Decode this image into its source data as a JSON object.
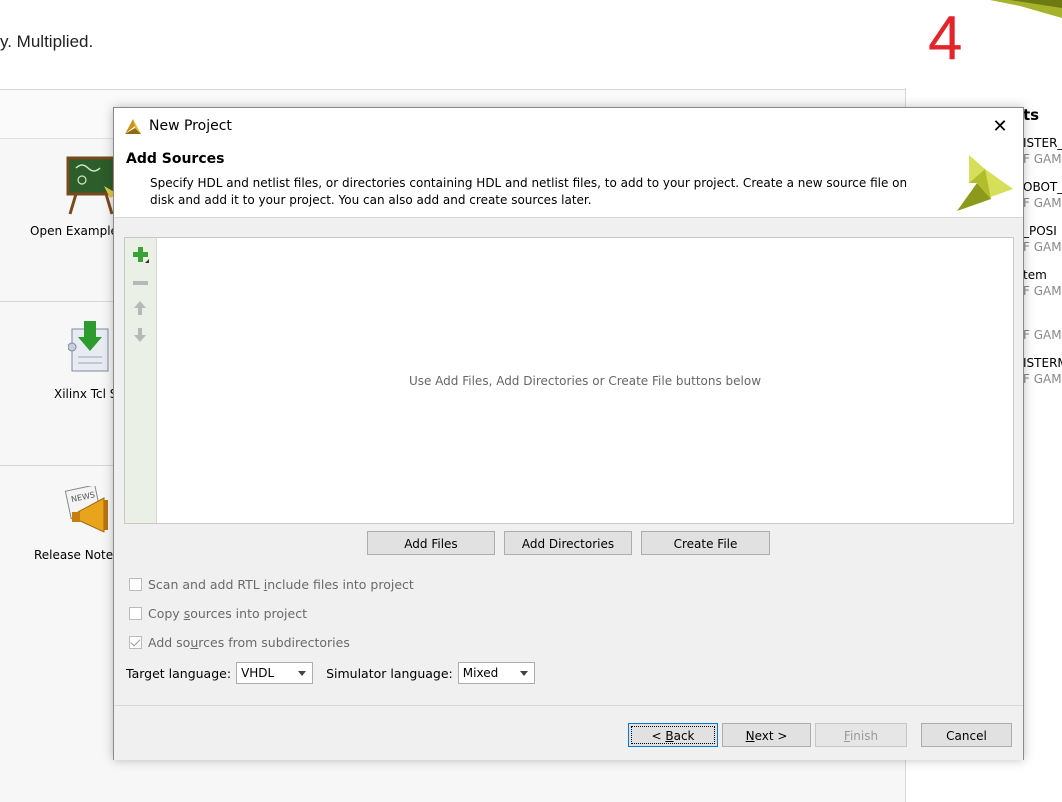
{
  "background": {
    "tagline": "y. Multiplied.",
    "badge_number": "4",
    "left_items": [
      {
        "label": "Open Example",
        "icon": "chalkboard-icon"
      },
      {
        "label": "Xilinx Tcl S",
        "icon": "tcl-store-download-icon"
      },
      {
        "label": "Release Note",
        "icon": "megaphone-news-icon"
      }
    ],
    "right_panel": {
      "heading": "ts",
      "entries": [
        {
          "title": "ISTER_",
          "sub": "F GAMI"
        },
        {
          "title": "OBOT_",
          "sub": "F GAMI"
        },
        {
          "title": "_POSI",
          "sub": "F GAMI"
        },
        {
          "title": "tem",
          "sub": "F GAMI"
        },
        {
          "title": "",
          "sub": "F GAMI"
        },
        {
          "title": "ISTERM",
          "sub": "F GAMI"
        }
      ]
    }
  },
  "dialog": {
    "window_title": "New Project",
    "close_glyph": "✕",
    "header": {
      "title": "Add Sources",
      "description": "Specify HDL and netlist files, or directories containing HDL and netlist files, to add to your project. Create a new source file on disk and add it to your project. You can also add and create sources later."
    },
    "toolbar": {
      "add_icon": "plus-icon",
      "remove_icon": "minus-icon",
      "up_icon": "arrow-up-icon",
      "down_icon": "arrow-down-icon"
    },
    "file_list_empty_text": "Use Add Files, Add Directories or Create File buttons below",
    "buttons": {
      "add_files": "Add Files",
      "add_directories": "Add Directories",
      "create_file": "Create File"
    },
    "options": {
      "scan_rtl": {
        "pre": "Scan and add RTL ",
        "mn": "i",
        "post": "nclude files into project",
        "checked": false
      },
      "copy_sources": {
        "pre": "Copy ",
        "mn": "s",
        "post": "ources into project",
        "checked": false
      },
      "add_subdirs": {
        "pre": "Add so",
        "mn": "u",
        "post": "rces from subdirectories",
        "checked": true
      }
    },
    "target_language": {
      "label": "Target language:",
      "value": "VHDL"
    },
    "simulator_language": {
      "label": "Simulator language:",
      "value": "Mixed"
    },
    "nav": {
      "back": {
        "pre": "< ",
        "mn": "B",
        "post": "ack"
      },
      "next": {
        "pre": "",
        "mn": "N",
        "post": "ext >"
      },
      "finish": {
        "pre": "",
        "mn": "F",
        "post": "inish"
      },
      "cancel": "Cancel"
    },
    "colors": {
      "accent_green": "#3aa335",
      "logo_olive": "#8c9a1c",
      "logo_light": "#d6df5a",
      "focus_blue": "#0078d7"
    }
  }
}
